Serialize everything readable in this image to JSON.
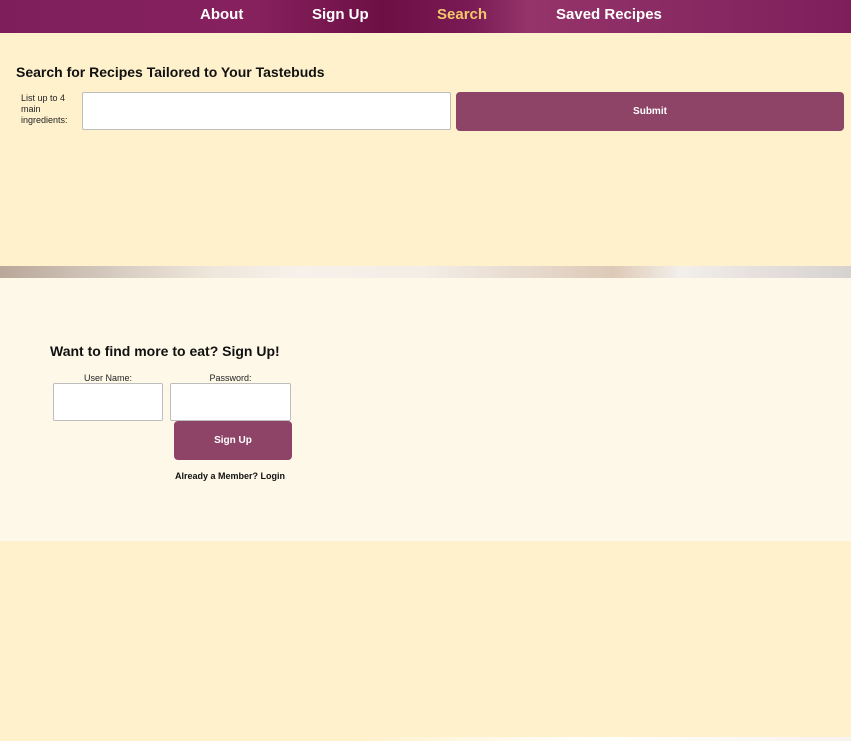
{
  "nav": {
    "items": [
      {
        "label": "About",
        "active": false
      },
      {
        "label": "Sign Up",
        "active": false
      },
      {
        "label": "Search",
        "active": true
      },
      {
        "label": "Saved Recipes",
        "active": false
      }
    ],
    "active_color": "#f2c86a"
  },
  "search": {
    "title": "Search for Recipes Tailored to Your Tastebuds",
    "ingredients_label": "List up to 4 main ingredients:",
    "ingredients_value": "",
    "submit_label": "Submit"
  },
  "signup": {
    "title": "Want to find more to eat? Sign Up!",
    "username_label": "User Name:",
    "username_value": "",
    "password_label": "Password:",
    "password_value": "",
    "button_label": "Sign Up",
    "login_link": "Already a Member? Login"
  },
  "colors": {
    "brand_purple": "#7e1f5c",
    "button_purple": "#8e4467",
    "cream": "#fef1cc",
    "light_cream": "#fef8e8"
  }
}
